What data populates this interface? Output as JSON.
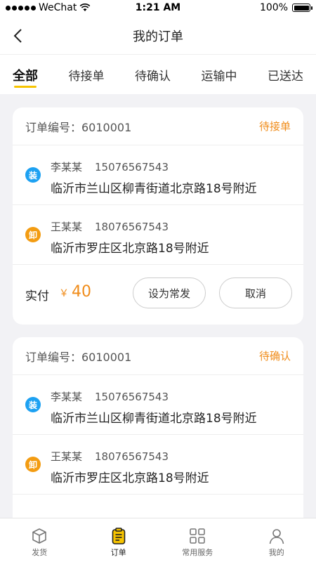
{
  "status_bar": {
    "carrier": "WeChat",
    "time": "1:21 AM",
    "battery": "100%",
    "battery_level": 1.0
  },
  "nav": {
    "title": "我的订单",
    "back_icon": "chevron-left-icon"
  },
  "tabs": [
    {
      "label": "全部",
      "active": true
    },
    {
      "label": "待接单"
    },
    {
      "label": "待确认"
    },
    {
      "label": "运输中"
    },
    {
      "label": "已送达"
    }
  ],
  "orders": [
    {
      "order_no": "订单编号：6010001",
      "status": "待接单",
      "stops": [
        {
          "badge": "装",
          "name": "李某某",
          "phone": "15076567543",
          "address": "临沂市兰山区柳青街道北京路18号附近"
        },
        {
          "badge": "卸",
          "name": "王某某",
          "phone": "18076567543",
          "address": "临沂市罗庄区北京路18号附近"
        }
      ],
      "pay_label": "实付",
      "currency": "￥",
      "amount": "40",
      "actions": {
        "often": "设为常发",
        "cancel": "取消"
      }
    },
    {
      "order_no": "订单编号：6010001",
      "status": "待确认",
      "stops": [
        {
          "badge": "装",
          "name": "李某某",
          "phone": "15076567543",
          "address": "临沂市兰山区柳青街道北京路18号附近"
        },
        {
          "badge": "卸",
          "name": "王某某",
          "phone": "18076567543",
          "address": "临沂市罗庄区北京路18号附近"
        }
      ]
    }
  ],
  "tabbar": [
    {
      "label": "发货",
      "icon": "box-icon"
    },
    {
      "label": "订单",
      "icon": "clipboard-icon",
      "active": true
    },
    {
      "label": "常用服务",
      "icon": "grid-icon"
    },
    {
      "label": "我的",
      "icon": "user-icon"
    }
  ],
  "colors": {
    "accent": "#f7c400",
    "status": "#f08c1a",
    "load": "#1da1f2",
    "unload": "#f39c12"
  }
}
